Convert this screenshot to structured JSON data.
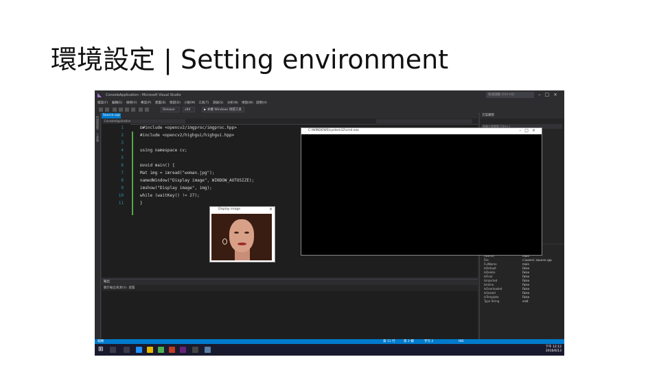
{
  "slide": {
    "title": "環境設定 | Setting environment"
  },
  "vs": {
    "window_title": "ConsoleApplication - Microsoft Visual Studio",
    "quick_launch": "快速啟動 (Ctrl+Q)",
    "menu": [
      "檔案(F)",
      "編輯(E)",
      "檢視(V)",
      "專案(P)",
      "建置(B)",
      "偵錯(D)",
      "小組(M)",
      "工具(T)",
      "測試(S)",
      "分析(N)",
      "視窗(W)",
      "說明(H)"
    ],
    "toolbar": {
      "config": "Release",
      "platform": "x64",
      "debugger": "▶ 本機 Windows 偵錯工具"
    },
    "left_strip": [
      "伺服器總管",
      "工具箱"
    ],
    "tab": "Source.cpp",
    "nav_scope": "ConsoleApplication",
    "code": [
      {
        "n": "1",
        "t": "⊟#include <opencv2/imgproc/imgproc.hpp>"
      },
      {
        "n": "2",
        "t": " #include <opencv2/highgui/highgui.hpp>"
      },
      {
        "n": "3",
        "t": ""
      },
      {
        "n": "4",
        "t": " using namespace cv;"
      },
      {
        "n": "5",
        "t": ""
      },
      {
        "n": "6",
        "t": "⊟void main() {"
      },
      {
        "n": "7",
        "t": "     Mat img = imread(\"woman.jpg\");"
      },
      {
        "n": "8",
        "t": "     namedWindow(\"Display image\", WINDOW_AUTOSIZE);"
      },
      {
        "n": "9",
        "t": "     imshow(\"Display image\", img);"
      },
      {
        "n": "10",
        "t": "     while (waitKey() != 27);"
      },
      {
        "n": "11",
        "t": " }"
      }
    ],
    "console_title": "C:\\WINDOWS\\system32\\cmd.exe",
    "photo_title": "Display image",
    "output": {
      "header": "輸出",
      "toolbar": "顯示輸出來源(S): 建置"
    },
    "right_panel": {
      "header": "方案總管",
      "search": "搜尋方案總管 (Ctrl+;)"
    },
    "properties": [
      {
        "k": "(Name)",
        "v": "main"
      },
      {
        "k": "File",
        "v": "c:\\users\\..\\source.cpp"
      },
      {
        "k": "FullName",
        "v": "main"
      },
      {
        "k": "IsDefault",
        "v": "False"
      },
      {
        "k": "IsDelete",
        "v": "False"
      },
      {
        "k": "IsFinal",
        "v": "False"
      },
      {
        "k": "IsInjected",
        "v": "False"
      },
      {
        "k": "IsInline",
        "v": "False"
      },
      {
        "k": "IsOverloaded",
        "v": "False"
      },
      {
        "k": "IsSealed",
        "v": "False"
      },
      {
        "k": "IsTemplate",
        "v": "False"
      },
      {
        "k": "Type String",
        "v": "void"
      }
    ],
    "status": {
      "left": "就緒",
      "ln": "第 11 行",
      "col": "第 2 欄",
      "ch": "字元 2",
      "ins": "INS"
    }
  },
  "taskbar": {
    "time": "下午 12:12",
    "date": "2016/6/13"
  },
  "colors": {
    "vs_dark": "#2d2d30",
    "editor_bg": "#1e1e1e",
    "accent": "#007acc"
  }
}
